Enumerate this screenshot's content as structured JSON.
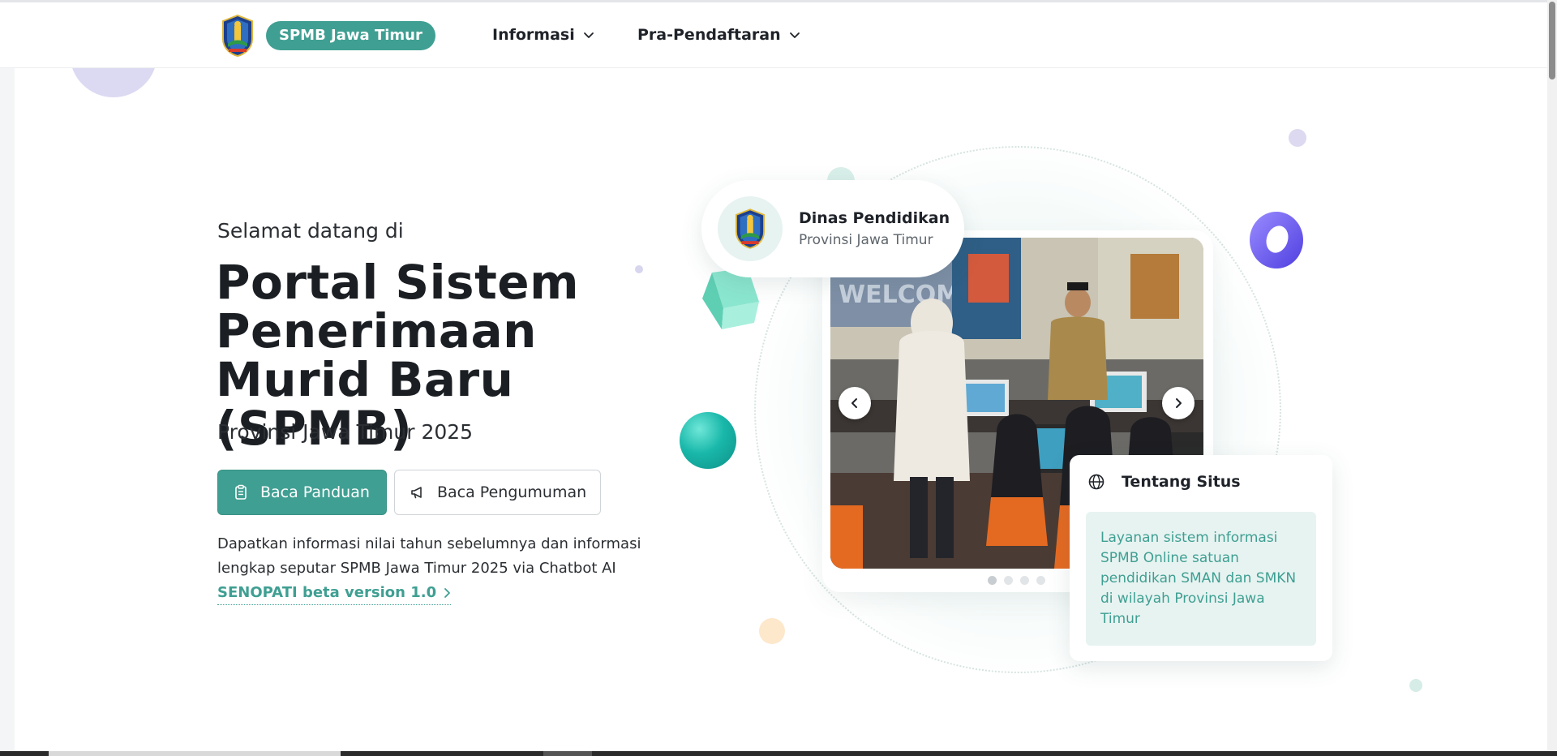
{
  "header": {
    "brand": "SPMB Jawa Timur",
    "nav": [
      {
        "label": "Informasi"
      },
      {
        "label": "Pra-Pendaftaran"
      }
    ]
  },
  "hero": {
    "welcome": "Selamat datang di",
    "title": "Portal Sistem Penerimaan Murid Baru (SPMB)",
    "subtitle": "Provinsi Jawa Timur 2025",
    "primary_button": "Baca Panduan",
    "secondary_button": "Baca Pengumuman",
    "description_lines": [
      "Dapatkan informasi nilai tahun sebelumnya dan informasi",
      "lengkap seputar SPMB Jawa Timur 2025 via Chatbot AI"
    ],
    "chatbot_link": "SENOPATI beta version 1.0"
  },
  "org_badge": {
    "name": "Dinas Pendidikan",
    "province": "Provinsi Jawa Timur"
  },
  "slider": {
    "slide_count": 4,
    "active_index": 0,
    "slide_banner_text": "WELCOME"
  },
  "about": {
    "title": "Tentang Situs",
    "body": "Layanan sistem informasi SPMB Online satuan pendidikan SMAN dan SMKN di wilayah Provinsi Jawa Timur"
  },
  "colors": {
    "accent": "#3f9f92",
    "accent_light": "#e7f3f1",
    "text": "#1f2329",
    "purple_ring": "#6b5cf0",
    "teal_ball": "#17b2a6",
    "mint_cube": "#7fe0c9"
  }
}
